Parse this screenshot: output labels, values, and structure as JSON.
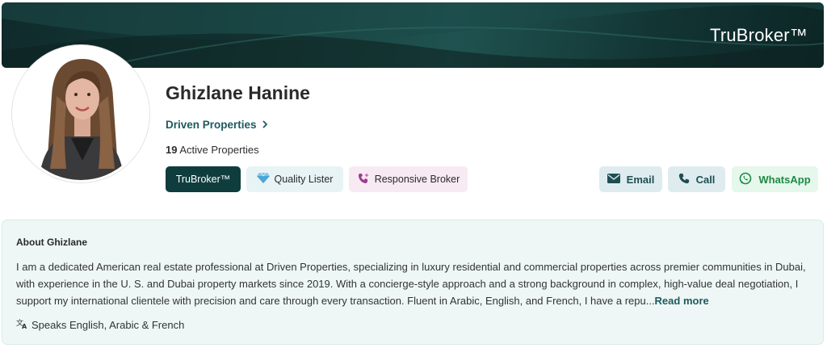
{
  "banner": {
    "brand": "TruBroker™"
  },
  "profile": {
    "name": "Ghizlane Hanine",
    "agency": "Driven Properties",
    "active_count": "19",
    "active_label": "Active Properties"
  },
  "badges": {
    "trubroker": "TruBroker™",
    "quality": "Quality Lister",
    "responsive": "Responsive Broker"
  },
  "actions": {
    "email": "Email",
    "call": "Call",
    "whatsapp": "WhatsApp"
  },
  "about": {
    "title": "About Ghizlane",
    "text": "I am a dedicated American real estate professional at Driven Properties, specializing in luxury residential and commercial properties across premier communities in Dubai, with experience in the U. S. and Dubai property markets since 2019. With a concierge-style approach and a strong background in complex, high-value deal negotiation, I support my international clientele with precision and care through every transaction. Fluent in Arabic, English, and French, I have a repu...",
    "read_more": "Read more",
    "languages": "Speaks English, Arabic & French"
  },
  "colors": {
    "brand_dark": "#0f3d3d",
    "link_teal": "#1d5a5e",
    "whatsapp_green": "#1d8a45",
    "about_bg": "#eef7f6"
  },
  "icons": {
    "agency": "chevron-right-icon",
    "quality": "diamond-icon",
    "responsive": "phone-sparkle-icon",
    "email": "envelope-icon",
    "call": "phone-icon",
    "whatsapp": "whatsapp-icon",
    "languages": "translate-icon"
  }
}
